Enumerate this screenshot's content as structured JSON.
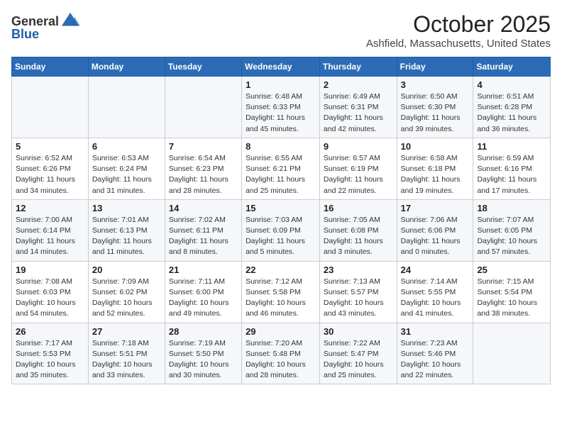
{
  "header": {
    "logo_general": "General",
    "logo_blue": "Blue",
    "month": "October 2025",
    "location": "Ashfield, Massachusetts, United States"
  },
  "weekdays": [
    "Sunday",
    "Monday",
    "Tuesday",
    "Wednesday",
    "Thursday",
    "Friday",
    "Saturday"
  ],
  "weeks": [
    [
      null,
      null,
      null,
      {
        "day": "1",
        "sunrise": "6:48 AM",
        "sunset": "6:33 PM",
        "daylight": "11 hours and 45 minutes."
      },
      {
        "day": "2",
        "sunrise": "6:49 AM",
        "sunset": "6:31 PM",
        "daylight": "11 hours and 42 minutes."
      },
      {
        "day": "3",
        "sunrise": "6:50 AM",
        "sunset": "6:30 PM",
        "daylight": "11 hours and 39 minutes."
      },
      {
        "day": "4",
        "sunrise": "6:51 AM",
        "sunset": "6:28 PM",
        "daylight": "11 hours and 36 minutes."
      }
    ],
    [
      {
        "day": "5",
        "sunrise": "6:52 AM",
        "sunset": "6:26 PM",
        "daylight": "11 hours and 34 minutes."
      },
      {
        "day": "6",
        "sunrise": "6:53 AM",
        "sunset": "6:24 PM",
        "daylight": "11 hours and 31 minutes."
      },
      {
        "day": "7",
        "sunrise": "6:54 AM",
        "sunset": "6:23 PM",
        "daylight": "11 hours and 28 minutes."
      },
      {
        "day": "8",
        "sunrise": "6:55 AM",
        "sunset": "6:21 PM",
        "daylight": "11 hours and 25 minutes."
      },
      {
        "day": "9",
        "sunrise": "6:57 AM",
        "sunset": "6:19 PM",
        "daylight": "11 hours and 22 minutes."
      },
      {
        "day": "10",
        "sunrise": "6:58 AM",
        "sunset": "6:18 PM",
        "daylight": "11 hours and 19 minutes."
      },
      {
        "day": "11",
        "sunrise": "6:59 AM",
        "sunset": "6:16 PM",
        "daylight": "11 hours and 17 minutes."
      }
    ],
    [
      {
        "day": "12",
        "sunrise": "7:00 AM",
        "sunset": "6:14 PM",
        "daylight": "11 hours and 14 minutes."
      },
      {
        "day": "13",
        "sunrise": "7:01 AM",
        "sunset": "6:13 PM",
        "daylight": "11 hours and 11 minutes."
      },
      {
        "day": "14",
        "sunrise": "7:02 AM",
        "sunset": "6:11 PM",
        "daylight": "11 hours and 8 minutes."
      },
      {
        "day": "15",
        "sunrise": "7:03 AM",
        "sunset": "6:09 PM",
        "daylight": "11 hours and 5 minutes."
      },
      {
        "day": "16",
        "sunrise": "7:05 AM",
        "sunset": "6:08 PM",
        "daylight": "11 hours and 3 minutes."
      },
      {
        "day": "17",
        "sunrise": "7:06 AM",
        "sunset": "6:06 PM",
        "daylight": "11 hours and 0 minutes."
      },
      {
        "day": "18",
        "sunrise": "7:07 AM",
        "sunset": "6:05 PM",
        "daylight": "10 hours and 57 minutes."
      }
    ],
    [
      {
        "day": "19",
        "sunrise": "7:08 AM",
        "sunset": "6:03 PM",
        "daylight": "10 hours and 54 minutes."
      },
      {
        "day": "20",
        "sunrise": "7:09 AM",
        "sunset": "6:02 PM",
        "daylight": "10 hours and 52 minutes."
      },
      {
        "day": "21",
        "sunrise": "7:11 AM",
        "sunset": "6:00 PM",
        "daylight": "10 hours and 49 minutes."
      },
      {
        "day": "22",
        "sunrise": "7:12 AM",
        "sunset": "5:58 PM",
        "daylight": "10 hours and 46 minutes."
      },
      {
        "day": "23",
        "sunrise": "7:13 AM",
        "sunset": "5:57 PM",
        "daylight": "10 hours and 43 minutes."
      },
      {
        "day": "24",
        "sunrise": "7:14 AM",
        "sunset": "5:55 PM",
        "daylight": "10 hours and 41 minutes."
      },
      {
        "day": "25",
        "sunrise": "7:15 AM",
        "sunset": "5:54 PM",
        "daylight": "10 hours and 38 minutes."
      }
    ],
    [
      {
        "day": "26",
        "sunrise": "7:17 AM",
        "sunset": "5:53 PM",
        "daylight": "10 hours and 35 minutes."
      },
      {
        "day": "27",
        "sunrise": "7:18 AM",
        "sunset": "5:51 PM",
        "daylight": "10 hours and 33 minutes."
      },
      {
        "day": "28",
        "sunrise": "7:19 AM",
        "sunset": "5:50 PM",
        "daylight": "10 hours and 30 minutes."
      },
      {
        "day": "29",
        "sunrise": "7:20 AM",
        "sunset": "5:48 PM",
        "daylight": "10 hours and 28 minutes."
      },
      {
        "day": "30",
        "sunrise": "7:22 AM",
        "sunset": "5:47 PM",
        "daylight": "10 hours and 25 minutes."
      },
      {
        "day": "31",
        "sunrise": "7:23 AM",
        "sunset": "5:46 PM",
        "daylight": "10 hours and 22 minutes."
      },
      null
    ]
  ]
}
